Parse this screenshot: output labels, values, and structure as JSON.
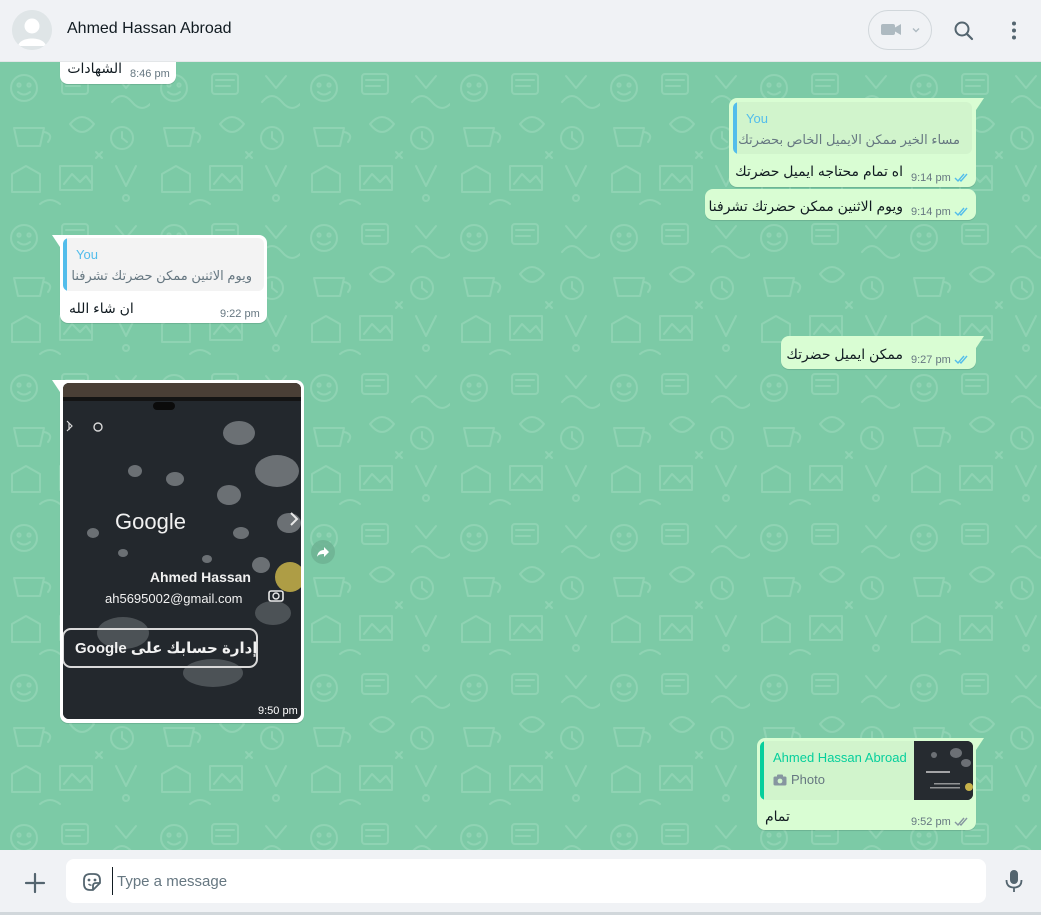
{
  "header": {
    "contact_name": "Ahmed Hassan Abroad",
    "icons": [
      "avatar-icon",
      "video-call-icon",
      "chevron-down-icon",
      "search-icon",
      "menu-icon"
    ]
  },
  "colors": {
    "chat_background": "#7ccaa6",
    "incoming_bubble": "#ffffff",
    "outgoing_bubble": "#d9fdd3",
    "read_ticks": "#53bdeb",
    "quote_you": "#53bdeb",
    "quote_contact": "#06cf9c"
  },
  "messages": [
    {
      "direction": "in",
      "text": "الشهادات",
      "time": "8:46 pm"
    },
    {
      "direction": "out",
      "quote_author": "You",
      "quote_text": "مساء الخير ممكن الايميل الخاص بحضرتك",
      "text": "اه تمام محتاجه ايميل حضرتك",
      "time": "9:14 pm",
      "status": "read"
    },
    {
      "direction": "out",
      "text": "ويوم الاثنين ممكن حضرتك تشرفنا",
      "time": "9:14 pm",
      "status": "read"
    },
    {
      "direction": "in",
      "quote_author": "You",
      "quote_text": "ويوم الاثنين ممكن حضرتك تشرفنا",
      "text": "ان شاء الله",
      "time": "9:22 pm"
    },
    {
      "direction": "out",
      "text": "ممكن ايميل حضرتك",
      "time": "9:27 pm",
      "status": "read"
    },
    {
      "direction": "in",
      "type": "image",
      "time": "9:50 pm",
      "image_content": {
        "brand": "Google",
        "name": "Ahmed Hassan",
        "email": "ah5695002@gmail.com",
        "button": "إدارة حسابك على Google"
      }
    },
    {
      "direction": "out",
      "quote_author": "Ahmed Hassan Abroad",
      "quote_type": "Photo",
      "text": "تمام",
      "time": "9:52 pm",
      "status": "delivered"
    }
  ],
  "composer": {
    "placeholder": "Type a message",
    "icons": [
      "plus-icon",
      "sticker-icon",
      "mic-icon"
    ]
  }
}
